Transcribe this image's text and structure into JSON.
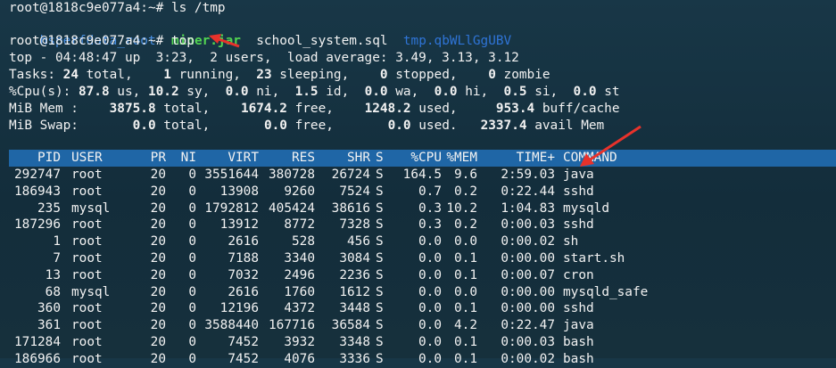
{
  "commands": {
    "line1": "root@1818c9e077a4:~# ls /tmp",
    "ls_output": [
      {
        "name": "hsperfdata_root",
        "kind": "dir"
      },
      {
        "name": "miner.jar",
        "kind": "exec"
      },
      {
        "name": "school_system.sql",
        "kind": "file"
      },
      {
        "name": "tmp.qbWLlGgUBV",
        "kind": "dir"
      }
    ],
    "line3": "root@1818c9e077a4:~# top"
  },
  "top_summary": {
    "line1": "top - 04:48:47 up  3:23,  2 users,  load average: 3.49, 3.13, 3.12",
    "tasks": {
      "label": "Tasks:",
      "total": "24",
      "running": "1",
      "sleeping": "23",
      "stopped": "0",
      "zombie": "0"
    },
    "cpu": {
      "label": "%Cpu(s):",
      "us": "87.8",
      "sy": "10.2",
      "ni": "0.0",
      "id": "1.5",
      "wa": "0.0",
      "hi": "0.0",
      "si": "0.5",
      "st": "0.0"
    },
    "mem": {
      "label": "MiB Mem :",
      "total": "3875.8",
      "free": "1674.2",
      "used": "1248.2",
      "buff_cache": "953.4"
    },
    "swap": {
      "label": "MiB Swap:",
      "total": "0.0",
      "free": "0.0",
      "used": "0.0",
      "avail": "2337.4"
    }
  },
  "process_table": {
    "headers": [
      "PID",
      "USER",
      "PR",
      "NI",
      "VIRT",
      "RES",
      "SHR",
      "S",
      "%CPU",
      "%MEM",
      "TIME+",
      "COMMAND"
    ],
    "rows": [
      [
        "292747",
        "root",
        "20",
        "0",
        "3551644",
        "380728",
        "26724",
        "S",
        "164.5",
        "9.6",
        "2:59.03",
        "java"
      ],
      [
        "186943",
        "root",
        "20",
        "0",
        "13908",
        "9260",
        "7524",
        "S",
        "0.7",
        "0.2",
        "0:22.44",
        "sshd"
      ],
      [
        "235",
        "mysql",
        "20",
        "0",
        "1792812",
        "405424",
        "38616",
        "S",
        "0.3",
        "10.2",
        "1:04.83",
        "mysqld"
      ],
      [
        "187296",
        "root",
        "20",
        "0",
        "13912",
        "8772",
        "7328",
        "S",
        "0.3",
        "0.2",
        "0:00.03",
        "sshd"
      ],
      [
        "1",
        "root",
        "20",
        "0",
        "2616",
        "528",
        "456",
        "S",
        "0.0",
        "0.0",
        "0:00.02",
        "sh"
      ],
      [
        "7",
        "root",
        "20",
        "0",
        "7188",
        "3340",
        "3084",
        "S",
        "0.0",
        "0.1",
        "0:00.00",
        "start.sh"
      ],
      [
        "13",
        "root",
        "20",
        "0",
        "7032",
        "2496",
        "2236",
        "S",
        "0.0",
        "0.1",
        "0:00.07",
        "cron"
      ],
      [
        "68",
        "mysql",
        "20",
        "0",
        "2616",
        "1760",
        "1612",
        "S",
        "0.0",
        "0.0",
        "0:00.00",
        "mysqld_safe"
      ],
      [
        "360",
        "root",
        "20",
        "0",
        "12196",
        "4372",
        "3448",
        "S",
        "0.0",
        "0.1",
        "0:00.00",
        "sshd"
      ],
      [
        "361",
        "root",
        "20",
        "0",
        "3588440",
        "167716",
        "36584",
        "S",
        "0.0",
        "4.2",
        "0:22.47",
        "java"
      ],
      [
        "171284",
        "root",
        "20",
        "0",
        "7452",
        "3932",
        "3348",
        "S",
        "0.0",
        "0.1",
        "0:00.03",
        "bash"
      ],
      [
        "186966",
        "root",
        "20",
        "0",
        "7452",
        "4076",
        "3336",
        "S",
        "0.0",
        "0.1",
        "0:00.02",
        "bash"
      ]
    ]
  },
  "colors": {
    "background": "#16303c",
    "header_bar": "#1f66a6",
    "annotation_arrow": "#e8322b",
    "dir": "#4a8fe0",
    "exec": "#52d552"
  }
}
